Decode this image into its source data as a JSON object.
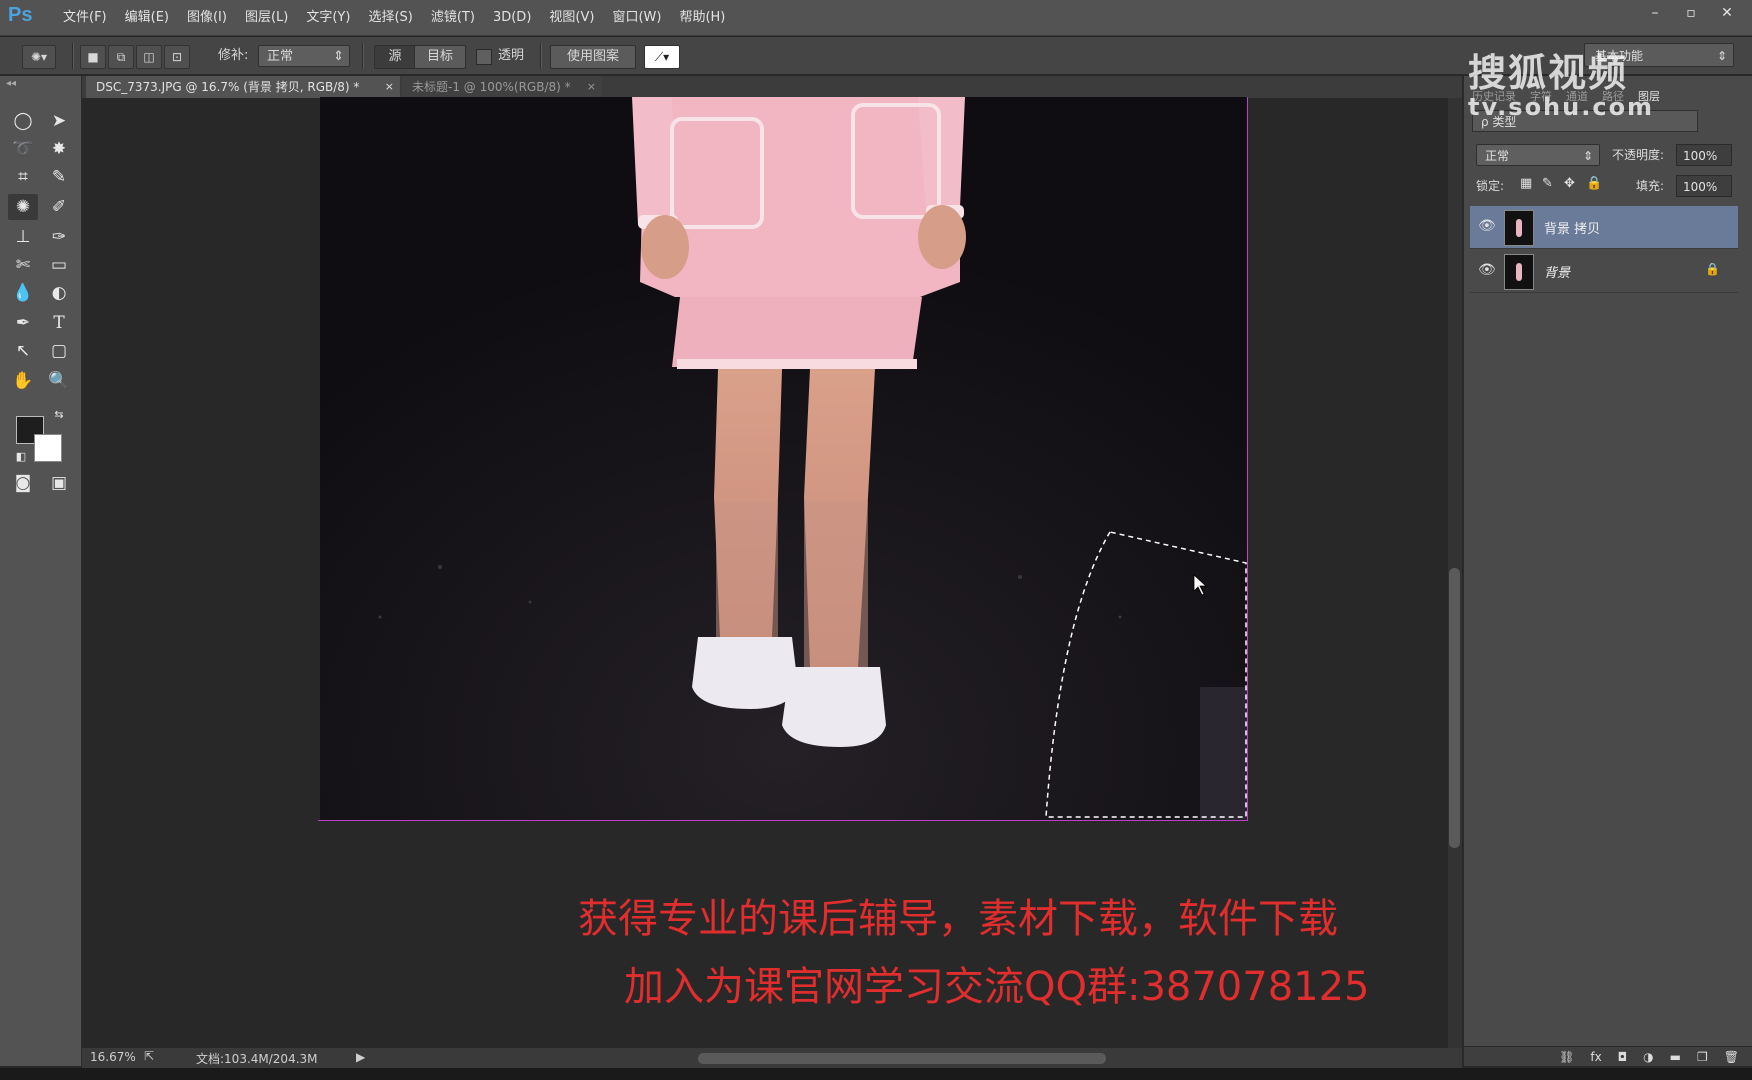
{
  "app": {
    "logo": "Ps",
    "menu": [
      "文件(F)",
      "编辑(E)",
      "图像(I)",
      "图层(L)",
      "文字(Y)",
      "选择(S)",
      "滤镜(T)",
      "3D(D)",
      "视图(V)",
      "窗口(W)",
      "帮助(H)"
    ],
    "window_controls": [
      "–",
      "▫",
      "✕"
    ]
  },
  "options_bar": {
    "patch_label": "修补:",
    "patch_mode": "正常",
    "source_button": "源",
    "target_button": "目标",
    "transparent_label": "透明",
    "use_pattern_button": "使用图案",
    "workspace": "基本功能"
  },
  "tabs": [
    {
      "label": "DSC_7373.JPG @ 16.7% (背景 拷贝, RGB/8) *",
      "close": "×"
    },
    {
      "label": "未标题-1 @ 100%(RGB/8) *",
      "close": "×"
    }
  ],
  "status": {
    "zoom": "16.67%",
    "doc_info": "文档:103.4M/204.3M"
  },
  "promo": {
    "line1": "获得专业的课后辅导，素材下载，软件下载",
    "line2": "加入为课官网学习交流QQ群:387078125"
  },
  "watermark": {
    "line1": "搜狐视频",
    "line2": "tv.sohu.com"
  },
  "layers_panel": {
    "tabs": [
      "历史记录",
      "字符",
      "通道",
      "路径",
      "图层"
    ],
    "active_tab": "图层",
    "filter": "ρ 类型",
    "blend_mode": "正常",
    "opacity_label": "不透明度:",
    "opacity": "100%",
    "lock_label": "锁定:",
    "fill_label": "填充:",
    "fill": "100%",
    "layers": [
      {
        "name": "背景 拷贝",
        "selected": true,
        "locked": false
      },
      {
        "name": "背景",
        "selected": false,
        "locked": true
      }
    ],
    "footer_icons": [
      "link-icon",
      "fx-icon",
      "mask-icon",
      "adjustment-icon",
      "folder-icon",
      "new-layer-icon",
      "trash-icon"
    ]
  }
}
